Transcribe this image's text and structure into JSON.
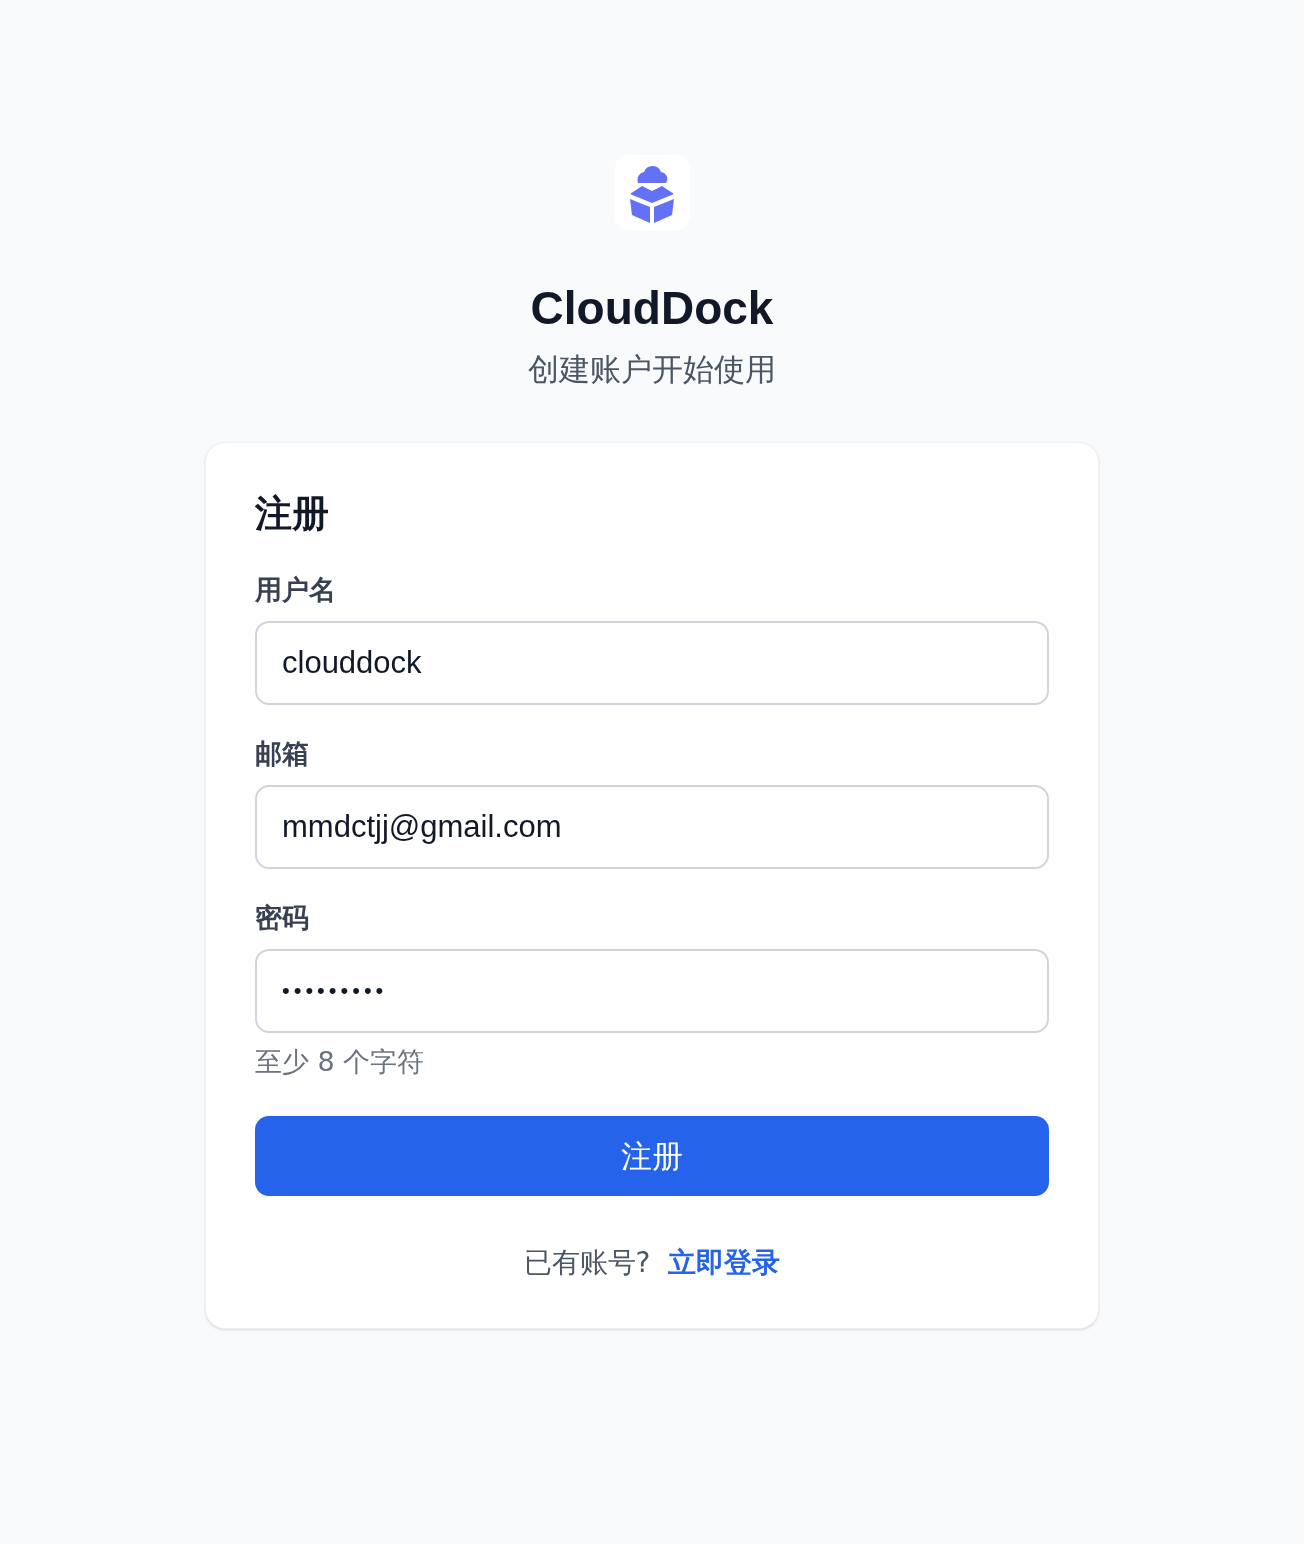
{
  "app": {
    "name": "CloudDock",
    "subtitle": "创建账户开始使用"
  },
  "form": {
    "title": "注册",
    "fields": [
      {
        "label": "用户名",
        "value": "clouddock",
        "kind": "text"
      },
      {
        "label": "邮箱",
        "value": "mmdctjj@gmail.com",
        "kind": "text"
      },
      {
        "label": "密码",
        "value": "•••••••••",
        "kind": "password",
        "hint": "至少 8 个字符"
      }
    ],
    "submit": "注册",
    "footer": {
      "text": "已有账号?",
      "link": "立即登录"
    }
  }
}
